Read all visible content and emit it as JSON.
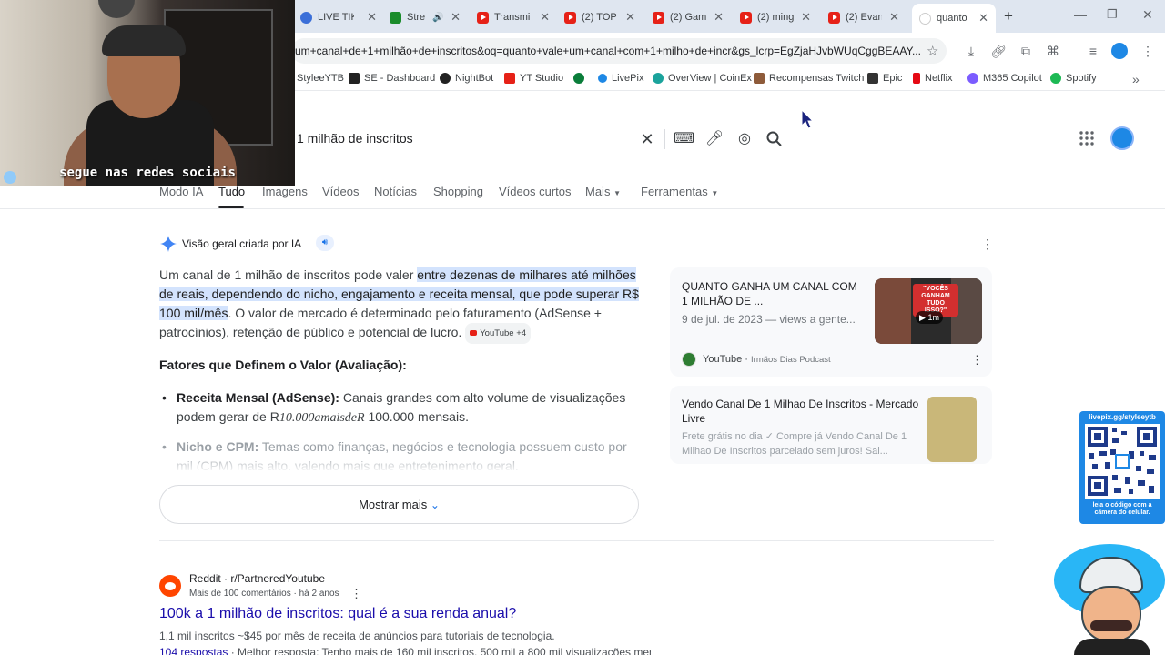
{
  "browser": {
    "tabs": [
      {
        "title": "LIVE TIK",
        "icon": "r"
      },
      {
        "title": "Stre",
        "icon": "k"
      },
      {
        "title": "Transmi",
        "icon": "yt"
      },
      {
        "title": "(2) TOP",
        "icon": "yt"
      },
      {
        "title": "(2) Gam",
        "icon": "yt"
      },
      {
        "title": "(2) ming",
        "icon": "yt"
      },
      {
        "title": "(2) Evan",
        "icon": "yt"
      },
      {
        "title": "quanto",
        "icon": "g"
      }
    ],
    "url": "um+canal+de+1+milhão+de+inscritos&oq=quanto+vale+um+canal+com+1+milho+de+incr&gs_lcrp=EgZjaHJvbWUqCggBEAAY...",
    "bookmarks": [
      {
        "label": "StyleeYTB",
        "color": "#888888"
      },
      {
        "label": "SE - Dashboard",
        "color": "#222222"
      },
      {
        "label": "NightBot",
        "color": "#222222"
      },
      {
        "label": "YT Studio",
        "color": "#e62117"
      },
      {
        "label": "",
        "color": "#0a7d3a"
      },
      {
        "label": "LivePix",
        "color": "#1e88e5"
      },
      {
        "label": "OverView | CoinEx",
        "color": "#1ba39c"
      },
      {
        "label": "Recompensas Twitch",
        "color": "#8e5b3a"
      },
      {
        "label": "Epic",
        "color": "#333333"
      },
      {
        "label": "Netflix",
        "color": "#e50914"
      },
      {
        "label": "M365 Copilot",
        "color": "#7b5cff"
      },
      {
        "label": "Spotify",
        "color": "#1db954"
      }
    ]
  },
  "search": {
    "query": "1 milhão de inscritos",
    "tabs": [
      "Modo IA",
      "Tudo",
      "Imagens",
      "Vídeos",
      "Notícias",
      "Shopping",
      "Vídeos curtos",
      "Mais",
      "Ferramentas"
    ]
  },
  "ai_overview": {
    "header": "Visão geral criada por IA",
    "p1_start": "Um canal de 1 milhão de inscritos pode valer ",
    "p1_highlight": "entre dezenas de milhares até milhões de reais, dependendo do nicho, engajamento e receita mensal, que pode superar R$ 100 mil/mês",
    "p1_end": ". O valor de mercado é determinado pelo faturamento (AdSense + patrocínios), retenção de público e potencial de lucro.",
    "chip": "YouTube +4",
    "factors_title": "Fatores que Definem o Valor (Avaliação):",
    "b1_title": "Receita Mensal (AdSense):",
    "b1_text": " Canais grandes com alto volume de visualizações podem gerar de R",
    "b1_math": "10.000amaisdeR",
    "b1_tail": " 100.000 mensais.",
    "b2_title": "Nicho e CPM:",
    "b2_text": " Temas como finanças, negócios e tecnologia possuem custo por mil (CPM) mais alto, valendo mais que entretenimento geral.",
    "show_more": "Mostrar mais"
  },
  "cards": [
    {
      "title": "QUANTO GANHA UM CANAL COM 1 MILHÃO DE ...",
      "meta": "9 de jul. de 2023 — views a gente...",
      "source": "YouTube",
      "sub": "Irmãos Dias Podcast",
      "thumb_text": "\"VOCÊS GANHAM TUDO ISSO?\"",
      "duration": "1m"
    },
    {
      "title": "Vendo Canal De 1 Milhao De Inscritos - Mercado Livre",
      "meta": "Frete grátis no dia ✓ Compre já Vendo Canal De 1 Milhao De Inscritos parcelado sem juros! Sai..."
    }
  ],
  "result": {
    "site": "Reddit · r/PartneredYoutube",
    "meta": "Mais de 100 comentários · há 2 anos",
    "title": "100k a 1 milhão de inscritos: qual é a sua renda anual?",
    "snippet": "1,1 mil inscritos ~$45 por mês de receita de anúncios para tutoriais de tecnologia.",
    "snippet2_link": "104 respostas",
    "snippet2": " · Melhor resposta: Tenho mais de 160 mil inscritos. 500 mil a 800 mil visualizações men..."
  },
  "overlay": {
    "webcam_caption": "segue nas redes sociais",
    "qr_title": "livepix.gg/styleeytb",
    "qr_caption": "leia o código com a câmera do celular."
  },
  "colors": {
    "link": "#1a0dab",
    "highlight": "#d3e3fd",
    "qr_bg": "#1e88e5"
  }
}
